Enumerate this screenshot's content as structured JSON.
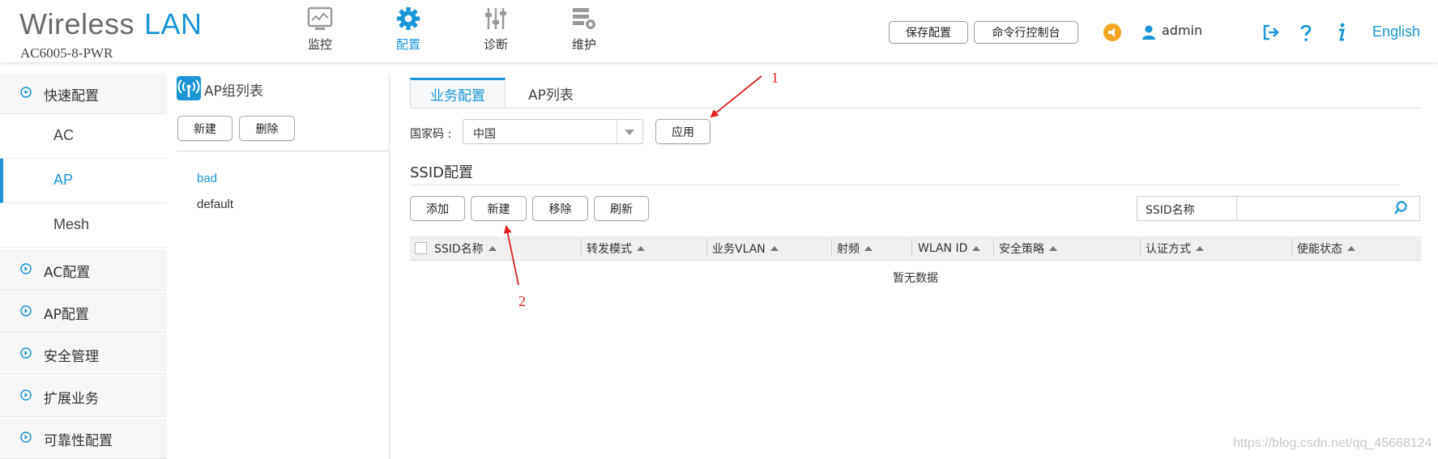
{
  "header": {
    "title_part1": "Wireless",
    "title_part2": "LAN",
    "model": "AC6005-8-PWR",
    "nav": [
      {
        "label": "监控",
        "icon": "monitor-icon"
      },
      {
        "label": "配置",
        "icon": "gear-icon",
        "active": true
      },
      {
        "label": "诊断",
        "icon": "sliders-icon"
      },
      {
        "label": "维护",
        "icon": "maintenance-icon"
      }
    ],
    "save_config": "保存配置",
    "cli_console": "命令行控制台",
    "user": "admin",
    "language": "English",
    "accent_color": "#1a95d6",
    "alert_color": "#f5a623"
  },
  "sidebar": {
    "groups": [
      {
        "label": "快速配置",
        "expanded": true
      },
      {
        "label": "AC配置"
      },
      {
        "label": "AP配置"
      },
      {
        "label": "安全管理"
      },
      {
        "label": "扩展业务"
      },
      {
        "label": "可靠性配置"
      }
    ],
    "subitems": [
      {
        "label": "AC"
      },
      {
        "label": "AP",
        "active": true
      },
      {
        "label": "Mesh"
      }
    ]
  },
  "group_panel": {
    "title": "AP组列表",
    "new_button": "新建",
    "delete_button": "删除",
    "items": [
      {
        "label": "bad",
        "selected": true
      },
      {
        "label": "default"
      }
    ]
  },
  "main": {
    "tabs": [
      {
        "label": "业务配置",
        "active": true
      },
      {
        "label": "AP列表"
      }
    ],
    "country_label": "国家码 :",
    "country_value": "中国",
    "apply_button": "应用",
    "ssid_section_title": "SSID配置",
    "toolbar": {
      "add": "添加",
      "new": "新建",
      "remove": "移除",
      "refresh": "刷新"
    },
    "search": {
      "label": "SSID名称",
      "value": ""
    },
    "table": {
      "columns": [
        "SSID名称",
        "转发模式",
        "业务VLAN",
        "射频",
        "WLAN ID",
        "安全策略",
        "认证方式",
        "使能状态"
      ],
      "empty_text": "暂无数据"
    }
  },
  "annotations": {
    "arrow1_number": "1",
    "arrow2_number": "2",
    "color": "#e02020"
  },
  "watermark": "https://blog.csdn.net/qq_45668124"
}
